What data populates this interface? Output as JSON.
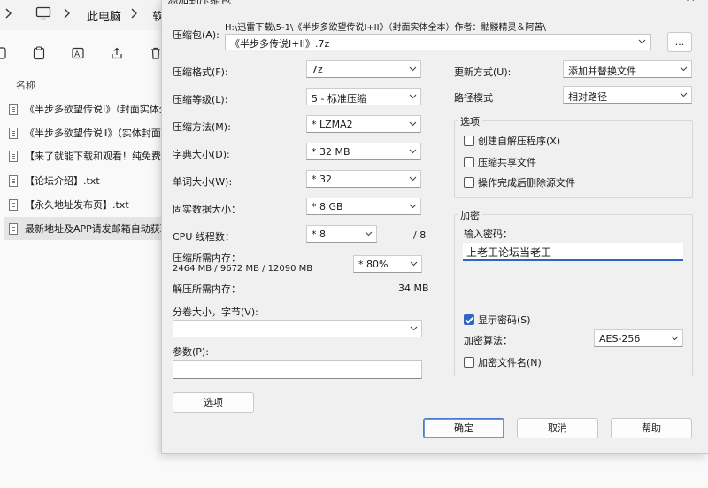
{
  "explorer": {
    "breadcrumb": [
      "此电脑",
      "软"
    ],
    "column_header": "名称",
    "files": [
      "《半步多欲望传说Ⅰ》（封面实体全本）",
      "《半步多欲望传说Ⅱ》（实体封面全本）",
      "【来了就能下载和观看！纯免费】",
      "【论坛介绍】.txt",
      "【永久地址发布页】.txt",
      "最新地址及APP请发邮箱自动获取"
    ]
  },
  "dialog": {
    "title": "添加到压缩包",
    "archive_label": "压缩包(A):",
    "archive_path": "H:\\迅雷下载\\5-1\\《半步多欲望传说I+II》（封面实体全本）作者：骷髅精灵＆阿苦\\",
    "archive_name": "《半步多传说I+II》.7z",
    "browse_label": "...",
    "format_label": "压缩格式(F):",
    "format_value": "7z",
    "level_label": "压缩等级(L):",
    "level_value": "5 - 标准压缩",
    "method_label": "压缩方法(M):",
    "method_value": "* LZMA2",
    "dict_label": "字典大小(D):",
    "dict_value": "* 32 MB",
    "word_label": "单词大小(W):",
    "word_value": "* 32",
    "solid_label": "固实数据大小：",
    "solid_value": "* 8 GB",
    "cpu_label": "CPU 线程数：",
    "cpu_value": "* 8",
    "cpu_total": "/ 8",
    "mem_comp_label": "压缩所需内存：",
    "mem_comp_detail": "2464 MB / 9672 MB / 12090 MB",
    "mem_percent": "* 80%",
    "mem_decomp_label": "解压所需内存：",
    "mem_decomp_value": "34 MB",
    "split_label": "分卷大小，字节(V):",
    "split_value": "",
    "params_label": "参数(P):",
    "params_value": "",
    "options_button": "选项",
    "update_label": "更新方式(U):",
    "update_value": "添加并替换文件",
    "path_label": "路径模式",
    "path_value": "相对路径",
    "options_group": "选项",
    "opt_sfx": "创建自解压程序(X)",
    "opt_shared": "压缩共享文件",
    "opt_delete": "操作完成后删除源文件",
    "encrypt_group": "加密",
    "pwd_label": "输入密码：",
    "pwd_value": "上老王论坛当老王",
    "show_pwd": "显示密码(S)",
    "enc_method_label": "加密算法：",
    "enc_method_value": "AES-256",
    "enc_names": "加密文件名(N)",
    "ok": "确定",
    "cancel": "取消",
    "help": "帮助"
  }
}
